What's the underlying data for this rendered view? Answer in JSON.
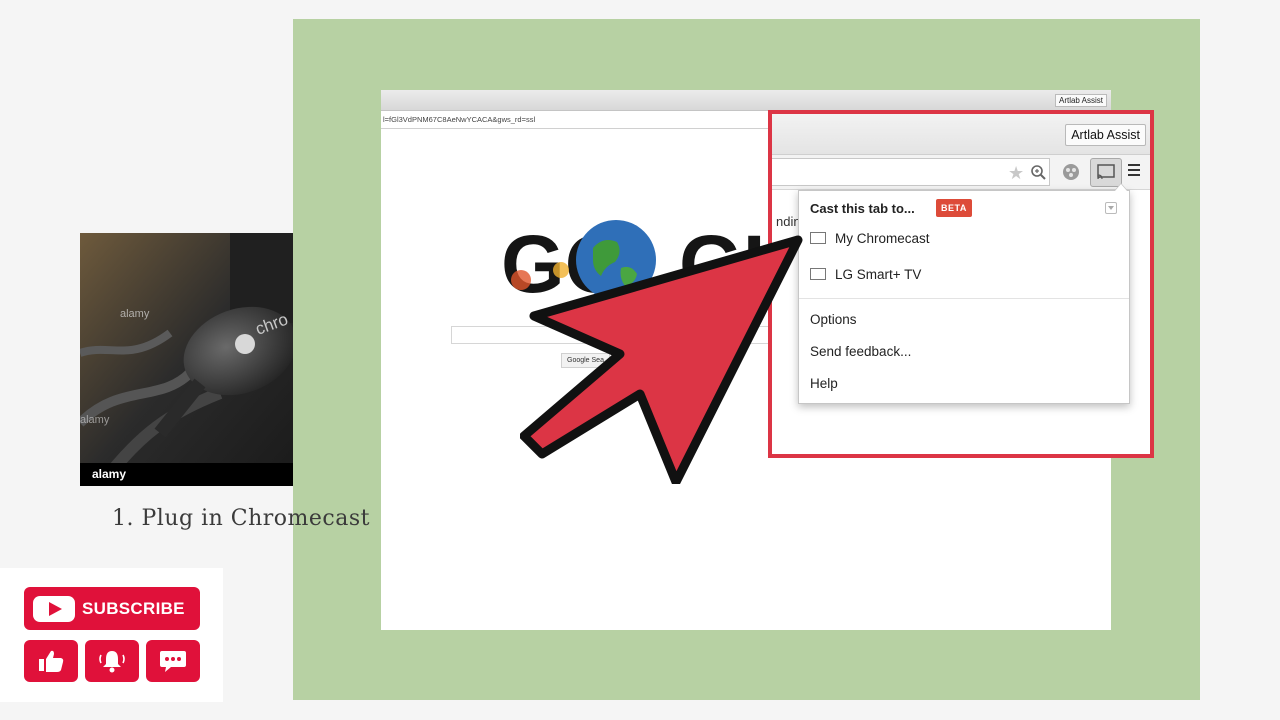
{
  "browser": {
    "url": "l=fGl3VdPNM67C8AeNwYCACA&gws_rd=ssl",
    "extension_label_small": "Artlab Assist",
    "search_button": "Google Sea",
    "trending_partial": "ndin"
  },
  "photo": {
    "watermark": "alamy",
    "device_text": "chro"
  },
  "step_caption": "1. Plug in Chromecast",
  "subscribe": {
    "label": "SUBSCRIBE",
    "icons": [
      "thumbs-up-icon",
      "bell-icon",
      "comment-icon"
    ],
    "color": "#e0113a"
  },
  "zoomed": {
    "extension_label": "Artlab Assist",
    "bg_text": "ndin",
    "popup": {
      "title": "Cast this tab to...",
      "badge": "BETA",
      "devices": [
        "My Chromecast",
        "LG Smart+ TV"
      ],
      "items": [
        "Options",
        "Send feedback...",
        "Help"
      ]
    },
    "highlight_color": "#dc3545"
  },
  "background_color": "#b7d1a3"
}
